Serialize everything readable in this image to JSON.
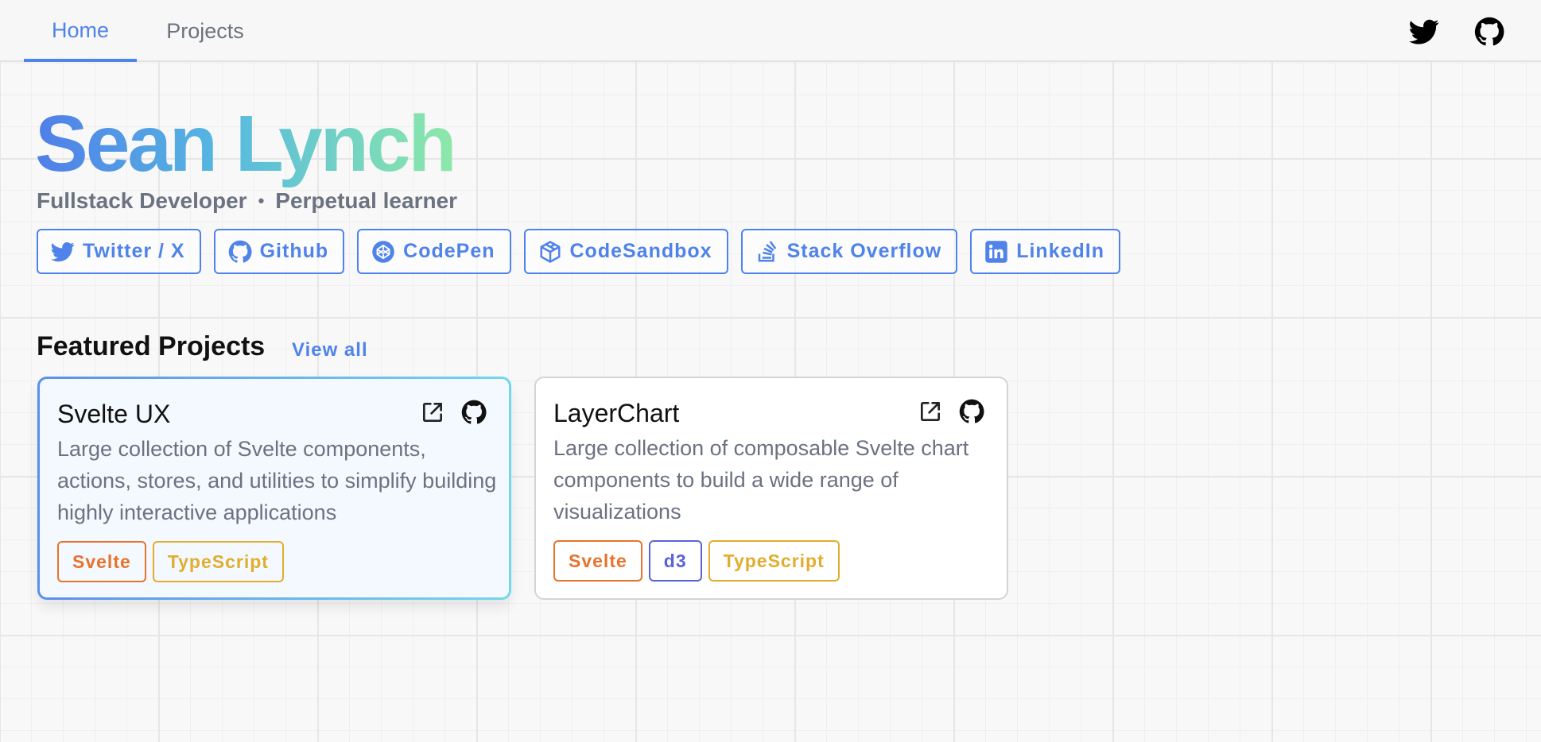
{
  "nav": {
    "tabs": [
      {
        "label": "Home",
        "active": true
      },
      {
        "label": "Projects",
        "active": false
      }
    ],
    "icons": [
      "twitter-icon",
      "github-icon"
    ]
  },
  "header": {
    "name": "Sean Lynch",
    "tagline": [
      "Fullstack Developer",
      "Perpetual learner"
    ],
    "separator": "•"
  },
  "socials": [
    {
      "label": "Twitter / X",
      "icon": "twitter-icon"
    },
    {
      "label": "Github",
      "icon": "github-icon"
    },
    {
      "label": "CodePen",
      "icon": "codepen-icon"
    },
    {
      "label": "CodeSandbox",
      "icon": "codesandbox-icon"
    },
    {
      "label": "Stack Overflow",
      "icon": "stackoverflow-icon"
    },
    {
      "label": "LinkedIn",
      "icon": "linkedin-icon"
    }
  ],
  "featured": {
    "title": "Featured Projects",
    "view_all": "View all",
    "projects": [
      {
        "title": "Svelte UX",
        "description": "Large collection of Svelte components, actions, stores, and utilities to simplify building highly interactive applications",
        "tags": [
          {
            "label": "Svelte",
            "color": "#e8722c"
          },
          {
            "label": "TypeScript",
            "color": "#e2ad2e"
          }
        ]
      },
      {
        "title": "LayerChart",
        "description": "Large collection of composable Svelte chart components to build a wide range of visualizations",
        "tags": [
          {
            "label": "Svelte",
            "color": "#e8722c"
          },
          {
            "label": "d3",
            "color": "#5a63d8"
          },
          {
            "label": "TypeScript",
            "color": "#e2ad2e"
          }
        ]
      }
    ]
  },
  "colors": {
    "accent": "#4f83ea",
    "gradient_start": "#4f7ee8",
    "gradient_end": "#8de9a8"
  }
}
